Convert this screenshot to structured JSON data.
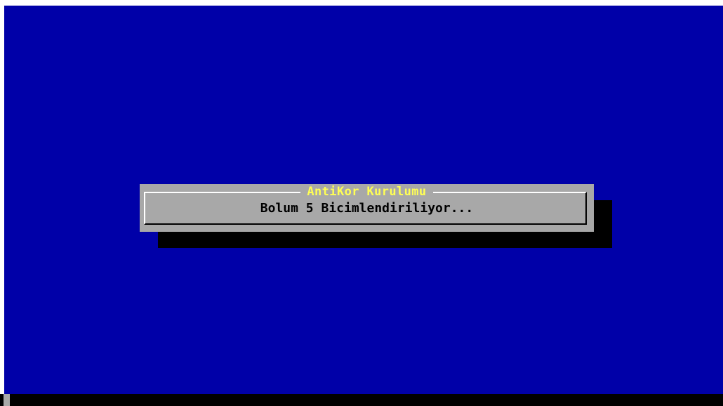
{
  "colors": {
    "background": "#0000a8",
    "dialog": "#a8a8a8",
    "title": "#ffff54",
    "message": "#000000",
    "shadow": "#000000"
  },
  "dialog": {
    "title": "AntiKor Kurulumu",
    "message": "Bolum 5 Bicimlendiriliyor..."
  }
}
